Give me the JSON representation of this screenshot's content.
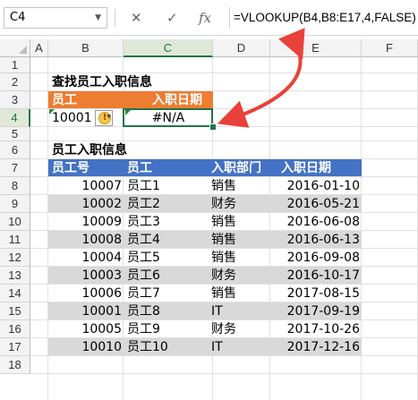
{
  "formula_bar": {
    "name_box": "C4",
    "cancel": "✕",
    "enter": "✓",
    "fx": "fx",
    "formula": "=VLOOKUP(B4,B8:E17,4,FALSE)"
  },
  "columns": [
    "A",
    "B",
    "C",
    "D",
    "E",
    "F"
  ],
  "rows": [
    "1",
    "2",
    "3",
    "4",
    "5",
    "6",
    "7",
    "8",
    "9",
    "10",
    "11",
    "12",
    "13",
    "14",
    "15",
    "16",
    "17",
    "18"
  ],
  "lookup": {
    "title": "查找员工入职信息",
    "header_employee": "员工",
    "header_date": "入职日期",
    "employee_id": "10001",
    "result": "#N/A"
  },
  "table": {
    "title": "员工入职信息",
    "headers": [
      "员工号",
      "员工",
      "入职部门",
      "入职日期"
    ],
    "rows": [
      [
        "10007",
        "员工1",
        "销售",
        "2016-01-10"
      ],
      [
        "10002",
        "员工2",
        "财务",
        "2016-05-21"
      ],
      [
        "10009",
        "员工3",
        "销售",
        "2016-06-08"
      ],
      [
        "10008",
        "员工4",
        "销售",
        "2016-06-13"
      ],
      [
        "10004",
        "员工5",
        "销售",
        "2016-09-08"
      ],
      [
        "10003",
        "员工6",
        "财务",
        "2016-10-17"
      ],
      [
        "10006",
        "员工7",
        "销售",
        "2017-08-15"
      ],
      [
        "10001",
        "员工8",
        "IT",
        "2017-09-19"
      ],
      [
        "10005",
        "员工9",
        "财务",
        "2017-10-26"
      ],
      [
        "10010",
        "员工10",
        "IT",
        "2017-12-16"
      ]
    ]
  },
  "colors": {
    "orange_header": "#ed7d31",
    "blue_header": "#4472c4",
    "stripe": "#d9d9d9",
    "selection": "#217346",
    "arrow": "#e8413a"
  }
}
